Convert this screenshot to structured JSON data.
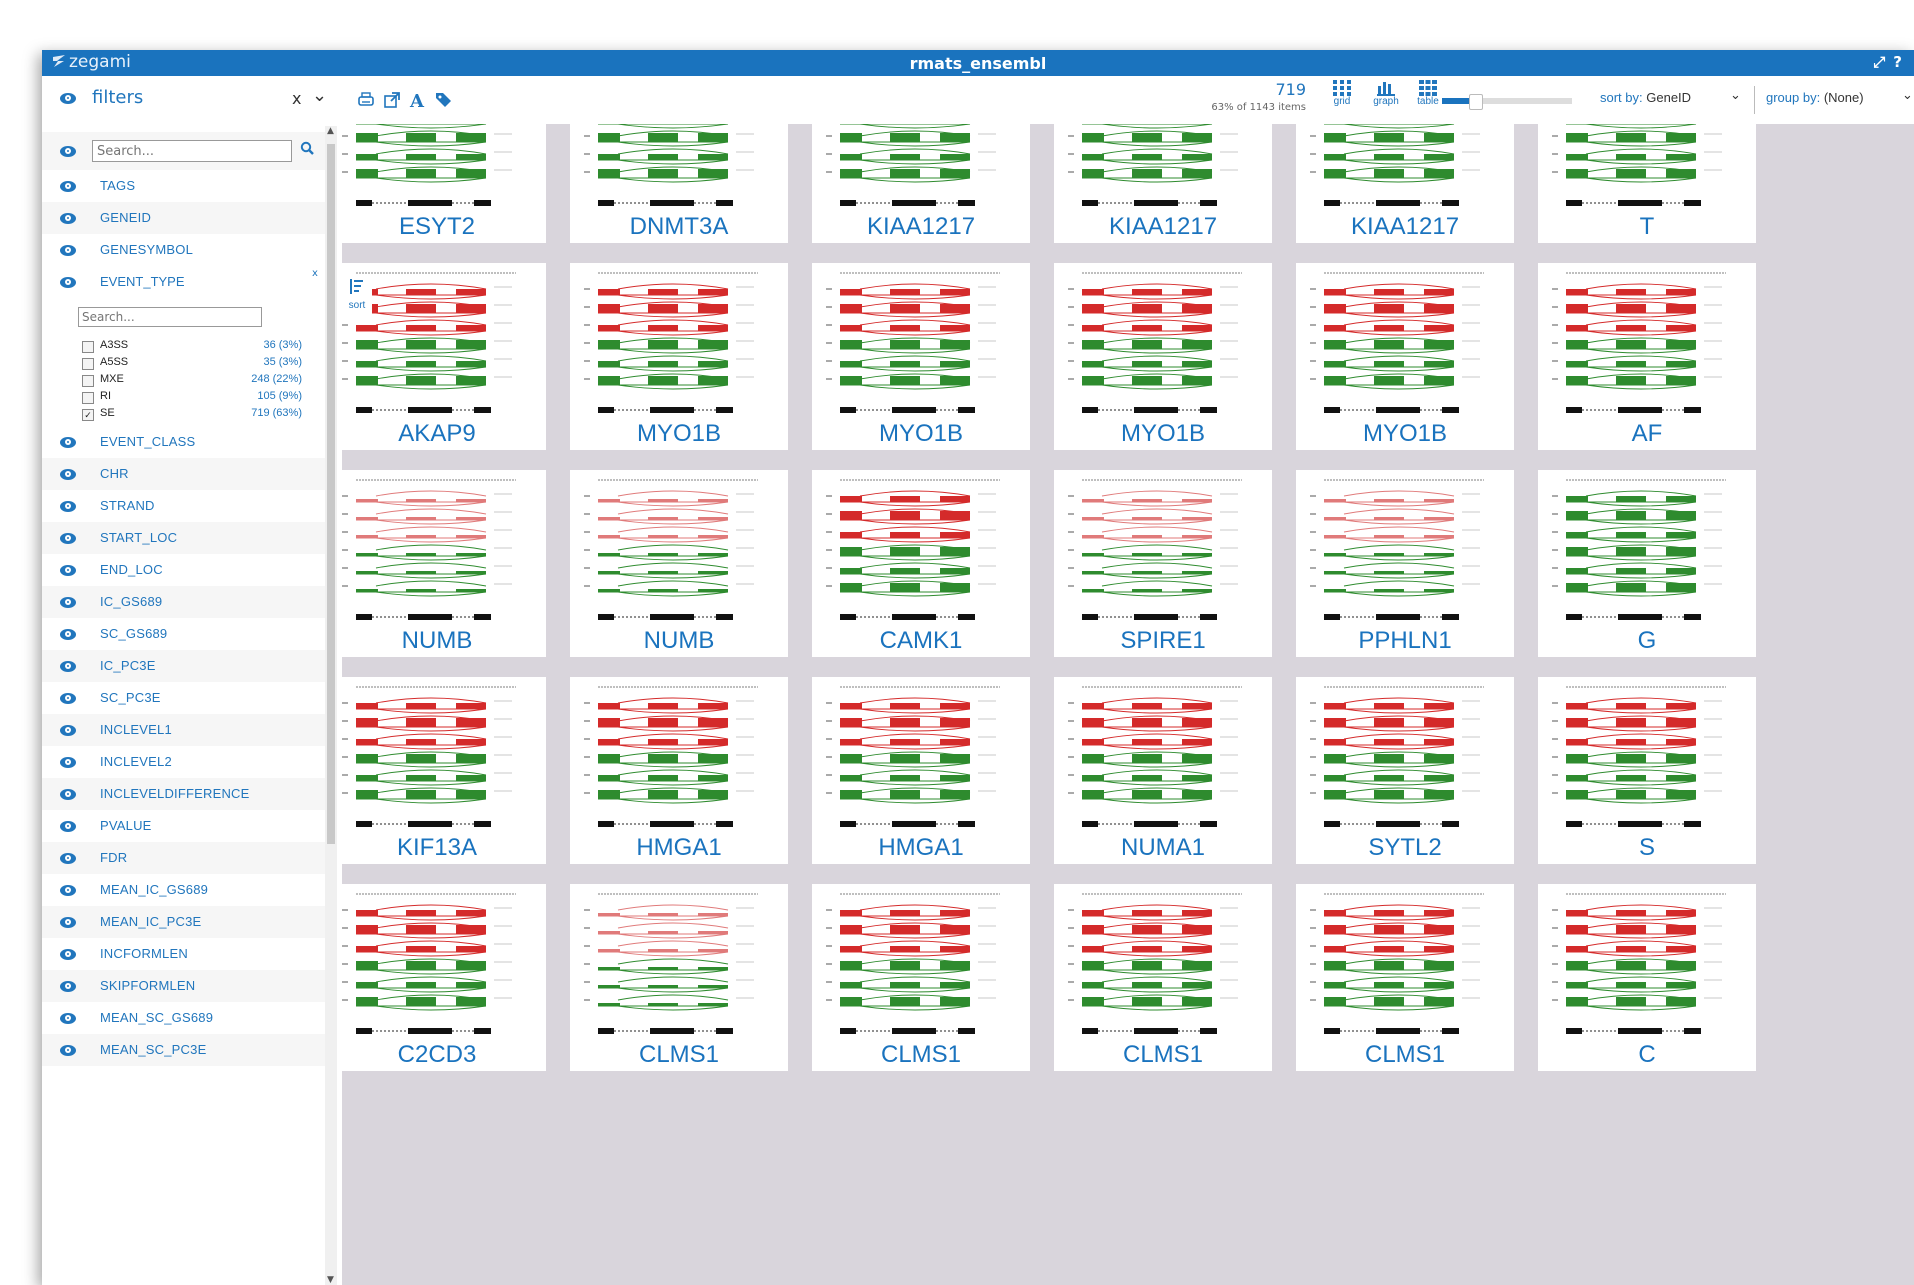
{
  "app": {
    "logo": "zegami",
    "title": "rmats_ensembl"
  },
  "sidebar": {
    "title": "filters",
    "close": "x",
    "search_placeholder": "Search...",
    "filters": [
      {
        "label": "TAGS"
      },
      {
        "label": "GENEID"
      },
      {
        "label": "GENESYMBOL"
      },
      {
        "label": "EVENT_CLASS"
      },
      {
        "label": "CHR"
      },
      {
        "label": "STRAND"
      },
      {
        "label": "START_LOC"
      },
      {
        "label": "END_LOC"
      },
      {
        "label": "IC_GS689"
      },
      {
        "label": "SC_GS689"
      },
      {
        "label": "IC_PC3E"
      },
      {
        "label": "SC_PC3E"
      },
      {
        "label": "INCLEVEL1"
      },
      {
        "label": "INCLEVEL2"
      },
      {
        "label": "INCLEVELDIFFERENCE"
      },
      {
        "label": "PVALUE"
      },
      {
        "label": "FDR"
      },
      {
        "label": "MEAN_IC_GS689"
      },
      {
        "label": "MEAN_IC_PC3E"
      },
      {
        "label": "INCFORMLEN"
      },
      {
        "label": "SKIPFORMLEN"
      },
      {
        "label": "MEAN_SC_GS689"
      },
      {
        "label": "MEAN_SC_PC3E"
      }
    ],
    "event_type": {
      "label": "EVENT_TYPE",
      "close": "x",
      "search_placeholder": "Search...",
      "options": [
        {
          "name": "A3SS",
          "count": "36 (3%)",
          "checked": false
        },
        {
          "name": "A5SS",
          "count": "35 (3%)",
          "checked": false
        },
        {
          "name": "MXE",
          "count": "248 (22%)",
          "checked": false
        },
        {
          "name": "RI",
          "count": "105 (9%)",
          "checked": false
        },
        {
          "name": "SE",
          "count": "719 (63%)",
          "checked": true
        }
      ]
    }
  },
  "toolbar": {
    "count": "719",
    "count_sub": "63% of 1143 items",
    "views": [
      {
        "label": "grid"
      },
      {
        "label": "graph"
      },
      {
        "label": "table"
      }
    ],
    "size_slider": 0.25,
    "sort_key": "sort by:",
    "sort_value": "GeneID",
    "group_key": "group by:",
    "group_value": "(None)",
    "sort_button": "sort"
  },
  "grid": {
    "colors": {
      "red": "#d42a2a",
      "green": "#2e8b2e",
      "label": "#1a73be"
    },
    "rows": [
      {
        "genes": [
          "ESYT2",
          "DNMT3A",
          "KIAA1217",
          "KIAA1217",
          "KIAA1217",
          "T"
        ],
        "palette": [
          "green",
          "green",
          "green",
          "green",
          "green",
          "green"
        ]
      },
      {
        "genes": [
          "AKAP9",
          "MYO1B",
          "MYO1B",
          "MYO1B",
          "MYO1B",
          "AF"
        ],
        "palette": [
          "red",
          "red",
          "red",
          "red",
          "red",
          "red"
        ]
      },
      {
        "genes": [
          "NUMB",
          "NUMB",
          "CAMK1",
          "SPIRE1",
          "PPHLN1",
          "G"
        ],
        "palette": [
          "redlight",
          "redlight",
          "red",
          "redlight",
          "redlight",
          "green"
        ]
      },
      {
        "genes": [
          "KIF13A",
          "HMGA1",
          "HMGA1",
          "NUMA1",
          "SYTL2",
          "S"
        ],
        "palette": [
          "red",
          "red",
          "red",
          "red",
          "red",
          "red"
        ]
      },
      {
        "genes": [
          "C2CD3",
          "CLMS1",
          "CLMS1",
          "CLMS1",
          "CLMS1",
          "C"
        ],
        "palette": [
          "red",
          "redlight",
          "red",
          "red",
          "red",
          "red"
        ]
      }
    ]
  }
}
